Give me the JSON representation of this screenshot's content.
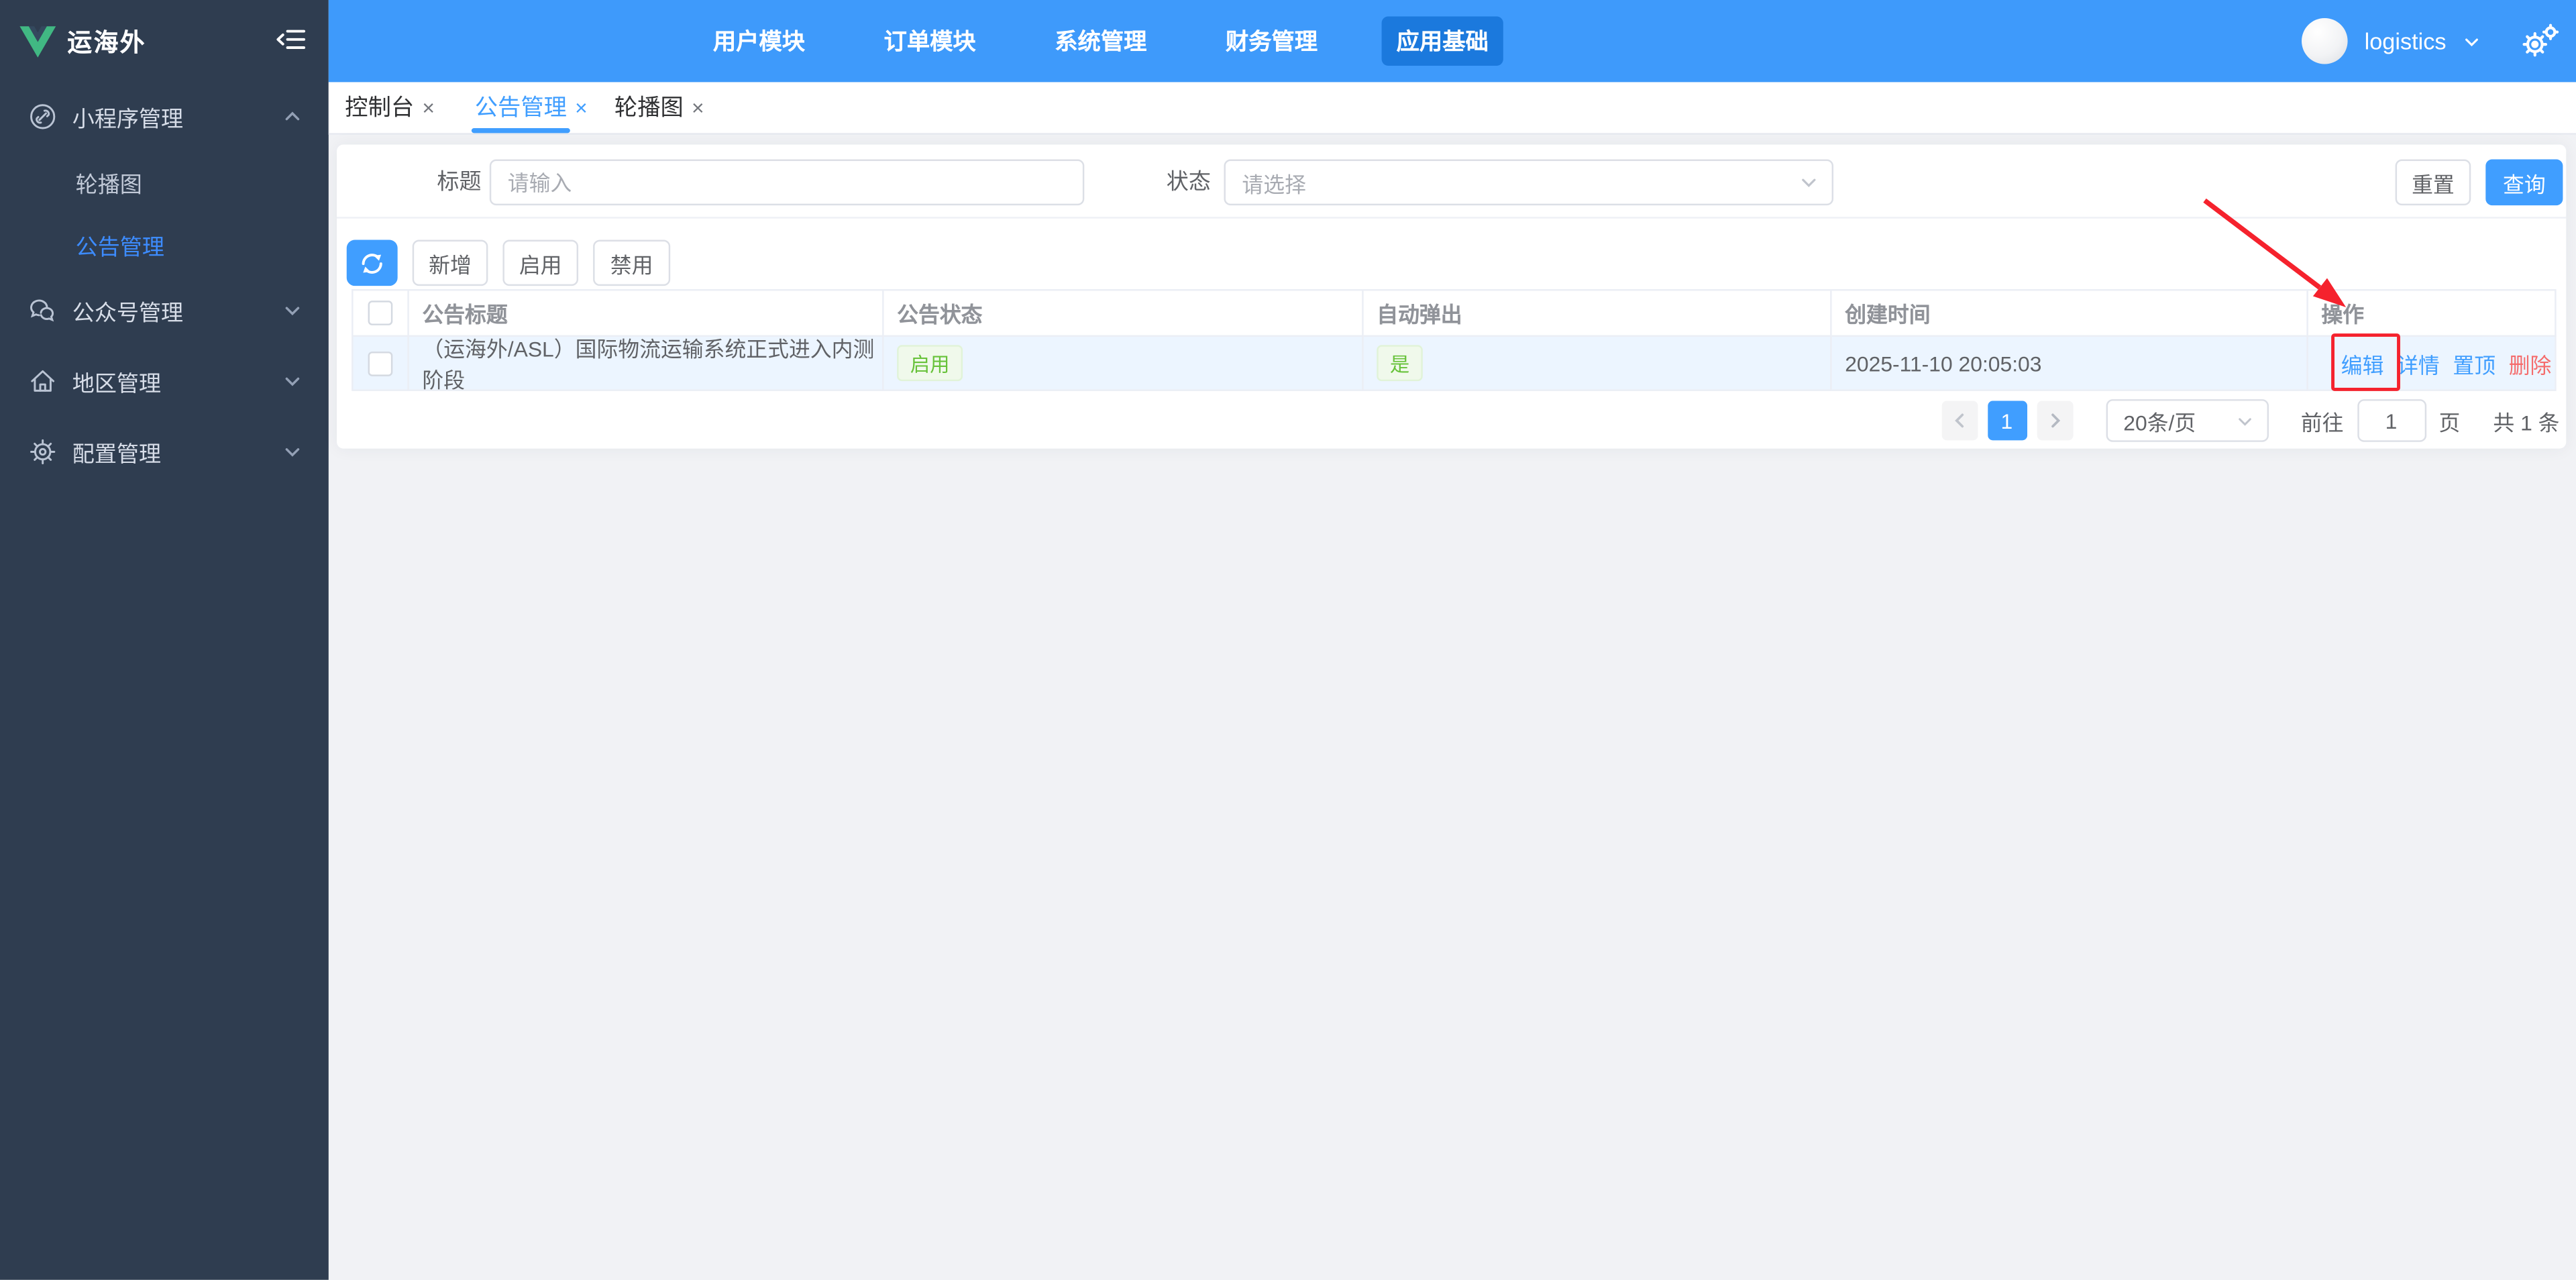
{
  "app": {
    "title": "运海外"
  },
  "sidebar": {
    "logo_text": "运海外",
    "menu": [
      {
        "label": "小程序管理",
        "icon": "link-icon",
        "expanded": true,
        "children": [
          {
            "label": "轮播图",
            "active": false
          },
          {
            "label": "公告管理",
            "active": true
          }
        ]
      },
      {
        "label": "公众号管理",
        "icon": "wechat-icon"
      },
      {
        "label": "地区管理",
        "icon": "home-icon"
      },
      {
        "label": "配置管理",
        "icon": "gear-icon"
      }
    ]
  },
  "topnav": {
    "modules": [
      {
        "label": "用户模块",
        "active": false
      },
      {
        "label": "订单模块",
        "active": false
      },
      {
        "label": "系统管理",
        "active": false
      },
      {
        "label": "财务管理",
        "active": false
      },
      {
        "label": "应用基础",
        "active": true
      }
    ],
    "username": "logistics"
  },
  "tabs": [
    {
      "label": "控制台",
      "close": "×",
      "active": false
    },
    {
      "label": "公告管理",
      "close": "×",
      "active": true
    },
    {
      "label": "轮播图",
      "close": "×",
      "active": false
    }
  ],
  "filters": {
    "title_label": "标题",
    "title_placeholder": "请输入",
    "status_label": "状态",
    "status_placeholder": "请选择",
    "reset_label": "重置",
    "search_label": "查询"
  },
  "toolbar": {
    "add_label": "新增",
    "enable_label": "启用",
    "disable_label": "禁用"
  },
  "table": {
    "headers": [
      "公告标题",
      "公告状态",
      "自动弹出",
      "创建时间",
      "操作"
    ],
    "row": {
      "title": "（运海外/ASL）国际物流运输系统正式进入内测阶段",
      "status": "启用",
      "auto_popup": "是",
      "created_at": "2025-11-10 20:05:03",
      "actions": [
        "编辑",
        "详情",
        "置顶",
        "删除"
      ]
    }
  },
  "pagination": {
    "current_page": "1",
    "page_size": "20条/页",
    "goto_label": "前往",
    "goto_value": "1",
    "page_unit": "页",
    "total_label": "共 1 条"
  },
  "colors": {
    "primary": "#409eff",
    "topbar": "#3e9afb",
    "topbar_active": "#1b79dd",
    "sidebar_bg": "#2f3d50",
    "sidebar_active_text": "#3d8cff",
    "row_highlight": "#ecf5ff",
    "tag_green_text": "#67c23a",
    "tag_green_bg": "#f0f9eb",
    "danger": "#f56c6c",
    "annotation_red": "#f5222d",
    "logo_green": "#41b883"
  }
}
